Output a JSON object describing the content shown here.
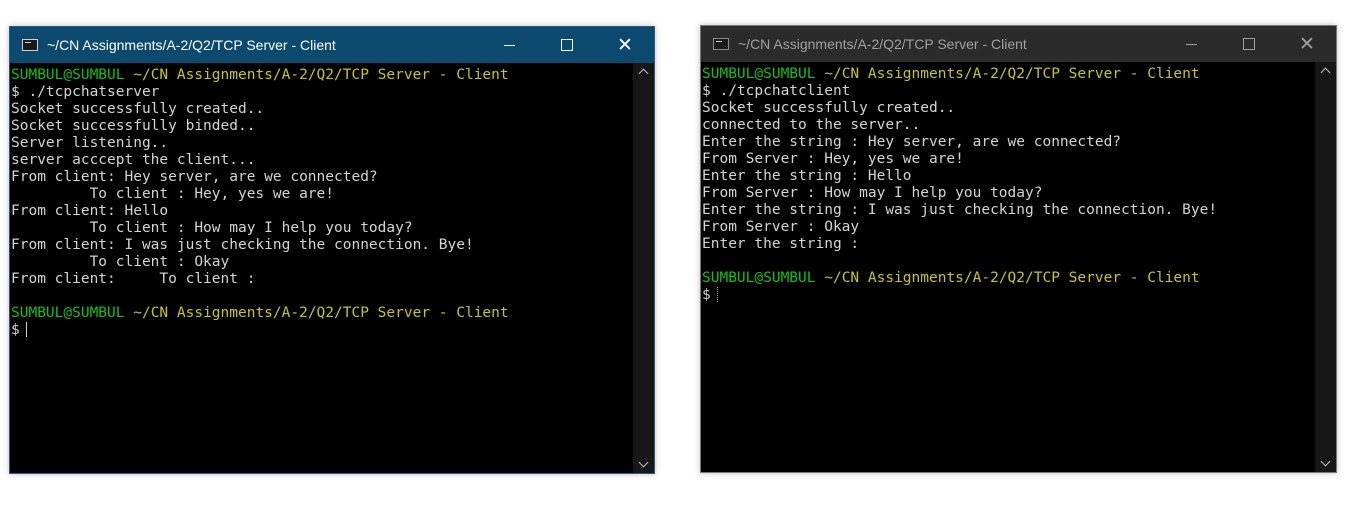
{
  "server_window": {
    "title": "~/CN Assignments/A-2/Q2/TCP Server - Client",
    "controls": {
      "minimize": "minimize",
      "maximize": "maximize",
      "close": "✕"
    },
    "prompt1_user": "SUMBUL@SUMBUL",
    "prompt1_path": "~/CN Assignments/A-2/Q2/TCP Server - Client",
    "output": [
      "$ ./tcpchatserver",
      "Socket successfully created..",
      "Socket successfully binded..",
      "Server listening..",
      "server acccept the client...",
      "From client: Hey server, are we connected?",
      "         To client : Hey, yes we are!",
      "From client: Hello",
      "         To client : How may I help you today?",
      "From client: I was just checking the connection. Bye!",
      "         To client : Okay",
      "From client:     To client :",
      ""
    ],
    "prompt2_user": "SUMBUL@SUMBUL",
    "prompt2_path": "~/CN Assignments/A-2/Q2/TCP Server - Client",
    "prompt_symbol": "$"
  },
  "client_window": {
    "title": "~/CN Assignments/A-2/Q2/TCP Server - Client",
    "controls": {
      "minimize": "minimize",
      "maximize": "maximize",
      "close": "✕"
    },
    "prompt1_user": "SUMBUL@SUMBUL",
    "prompt1_path": "~/CN Assignments/A-2/Q2/TCP Server - Client",
    "output": [
      "$ ./tcpchatclient",
      "Socket successfully created..",
      "connected to the server..",
      "Enter the string : Hey server, are we connected?",
      "From Server : Hey, yes we are!",
      "Enter the string : Hello",
      "From Server : How may I help you today?",
      "Enter the string : I was just checking the connection. Bye!",
      "From Server : Okay",
      "Enter the string :",
      ""
    ],
    "prompt2_user": "SUMBUL@SUMBUL",
    "prompt2_path": "~/CN Assignments/A-2/Q2/TCP Server - Client",
    "prompt_symbol": "$"
  },
  "colors": {
    "active_titlebar": "#0b4a6e",
    "inactive_titlebar": "#2b2b2b",
    "prompt_user": "#13c113",
    "prompt_path": "#c7c71b",
    "terminal_text": "#d4d4d4"
  }
}
